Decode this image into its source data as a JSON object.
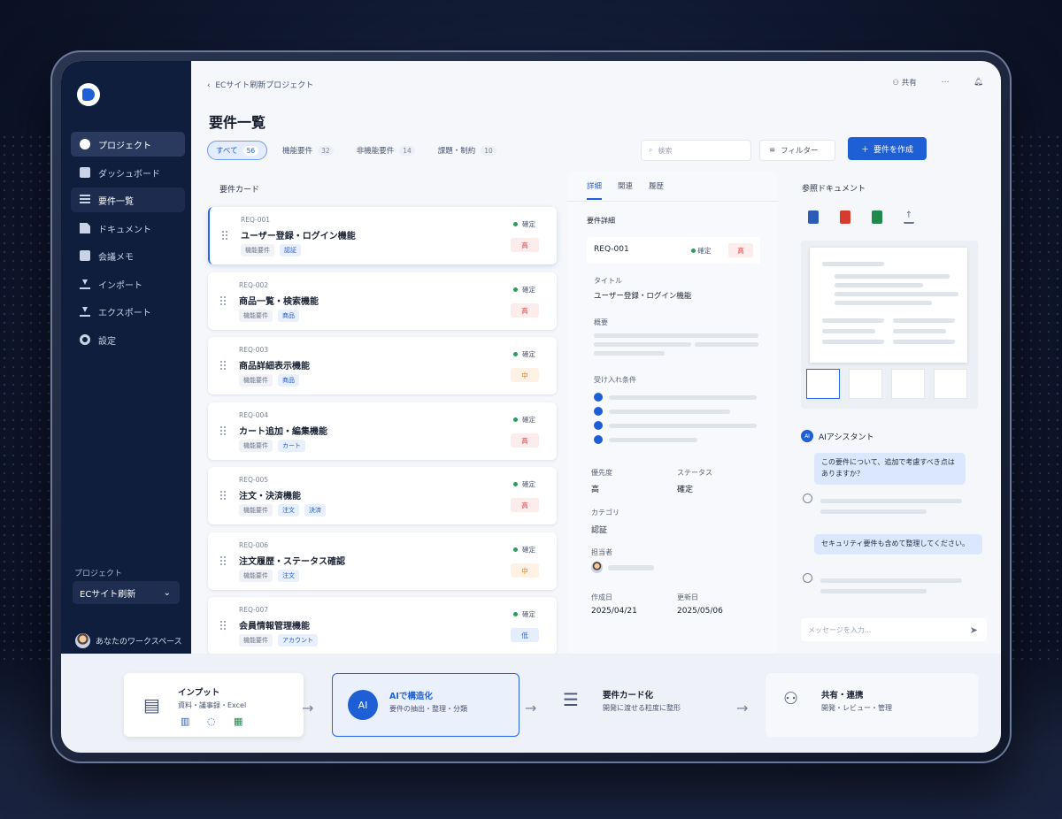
{
  "breadcrumb": "ECサイト刷新プロジェクト",
  "topbar": {
    "share": "共有",
    "more": "⋯"
  },
  "sidebar": {
    "items": [
      {
        "label": "プロジェクト"
      },
      {
        "label": "ダッシュボード"
      },
      {
        "label": "要件一覧"
      },
      {
        "label": "ドキュメント"
      },
      {
        "label": "会議メモ"
      },
      {
        "label": "インポート"
      },
      {
        "label": "エクスポート"
      },
      {
        "label": "設定"
      }
    ],
    "project_label": "プロジェクト",
    "project_value": "ECサイト刷新",
    "workspace": "あなたのワークスペース"
  },
  "page_title": "要件一覧",
  "filter_tabs": [
    {
      "label": "すべて",
      "count": "56"
    },
    {
      "label": "機能要件",
      "count": "32"
    },
    {
      "label": "非機能要件",
      "count": "14"
    },
    {
      "label": "課題・制約",
      "count": "10"
    }
  ],
  "search_placeholder": "検索",
  "filter_label": "フィルター",
  "create_label": "要件を作成",
  "cards_title": "要件カード",
  "cards": [
    {
      "id": "REQ-001",
      "title": "ユーザー登録・ログイン機能",
      "tags": [
        "機能要件",
        "認証"
      ],
      "status": "確定",
      "priority": "高"
    },
    {
      "id": "REQ-002",
      "title": "商品一覧・検索機能",
      "tags": [
        "機能要件",
        "商品"
      ],
      "status": "確定",
      "priority": "高"
    },
    {
      "id": "REQ-003",
      "title": "商品詳細表示機能",
      "tags": [
        "機能要件",
        "商品"
      ],
      "status": "確定",
      "priority": "中"
    },
    {
      "id": "REQ-004",
      "title": "カート追加・編集機能",
      "tags": [
        "機能要件",
        "カート"
      ],
      "status": "確定",
      "priority": "高"
    },
    {
      "id": "REQ-005",
      "title": "注文・決済機能",
      "tags": [
        "機能要件",
        "注文",
        "決済"
      ],
      "status": "確定",
      "priority": "高"
    },
    {
      "id": "REQ-006",
      "title": "注文履歴・ステータス確認",
      "tags": [
        "機能要件",
        "注文"
      ],
      "status": "確定",
      "priority": "中"
    },
    {
      "id": "REQ-007",
      "title": "会員情報管理機能",
      "tags": [
        "機能要件",
        "アカウント"
      ],
      "status": "確定",
      "priority": "低"
    }
  ],
  "detail": {
    "tabs": [
      "詳細",
      "関連",
      "履歴"
    ],
    "section": "要件詳細",
    "req_id": "REQ-001",
    "status": "確定",
    "priority": "高",
    "title_label": "タイトル",
    "title_value": "ユーザー登録・ログイン機能",
    "summary_label": "概要",
    "acceptance_label": "受け入れ条件",
    "priority_label": "優先度",
    "priority_value": "高",
    "status_label": "ステータス",
    "status_value": "確定",
    "category_label": "カテゴリ",
    "category_value": "認証",
    "owner_label": "担当者",
    "created_label": "作成日",
    "created_value": "2025/04/21",
    "updated_label": "更新日",
    "updated_value": "2025/05/06"
  },
  "reference": {
    "title": "参照ドキュメント",
    "file_icons": [
      "word-icon",
      "pdf-icon",
      "excel-icon",
      "upload-icon"
    ]
  },
  "assistant": {
    "title": "AIアシスタント",
    "badge": "AI",
    "message1": "この要件について、追加で考慮すべき点はありますか？",
    "message2": "セキュリティ要件も含めて整理してください。",
    "input_placeholder": "メッセージを入力..."
  },
  "flow": [
    {
      "title": "インプット",
      "sub": "資料・議事録・Excel"
    },
    {
      "title": "AIで構造化",
      "sub": "要件の抽出・整理・分類",
      "badge": "AI"
    },
    {
      "title": "要件カード化",
      "sub": "開発に渡せる粒度に整形"
    },
    {
      "title": "共有・連携",
      "sub": "開発・レビュー・管理"
    }
  ],
  "colors": {
    "accent": "#1f5fd6",
    "sidebar": "#0f1e3d",
    "high": "#d43a3a",
    "mid": "#d97a1e",
    "low": "#2559c9",
    "ok": "#2a9d5a"
  }
}
